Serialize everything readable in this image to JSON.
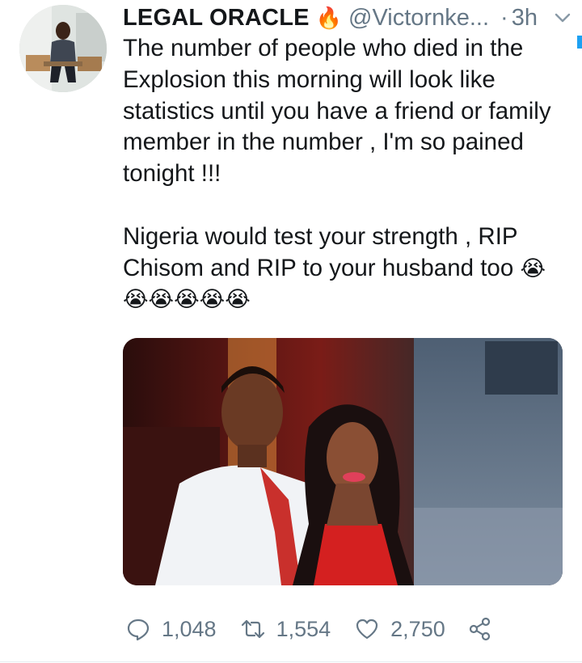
{
  "tweet": {
    "author_name": "LEGAL ORACLE",
    "author_emoji": "🔥",
    "handle": "@Victornke...",
    "separator": "·",
    "time": "3h",
    "lines": [
      "The number of people who died in the",
      "Explosion this morning will look like",
      "statistics until you have a friend or family",
      "member in the number , I'm so pained",
      "tonight !!!"
    ],
    "para2": [
      "Nigeria would test your strength , RIP",
      "Chisom and RIP to your husband too"
    ],
    "crying_emoji": "😭",
    "crying_row": "😭😭😭😭😭"
  },
  "actions": {
    "replies": "1,048",
    "retweets": "1,554",
    "likes": "2,750"
  },
  "icons": {
    "reply": "reply-icon",
    "retweet": "retweet-icon",
    "like": "heart-icon",
    "share": "share-icon",
    "menu": "chevron-down-icon"
  },
  "colors": {
    "text": "#14171a",
    "muted": "#657786",
    "accent": "#1da1f2"
  }
}
